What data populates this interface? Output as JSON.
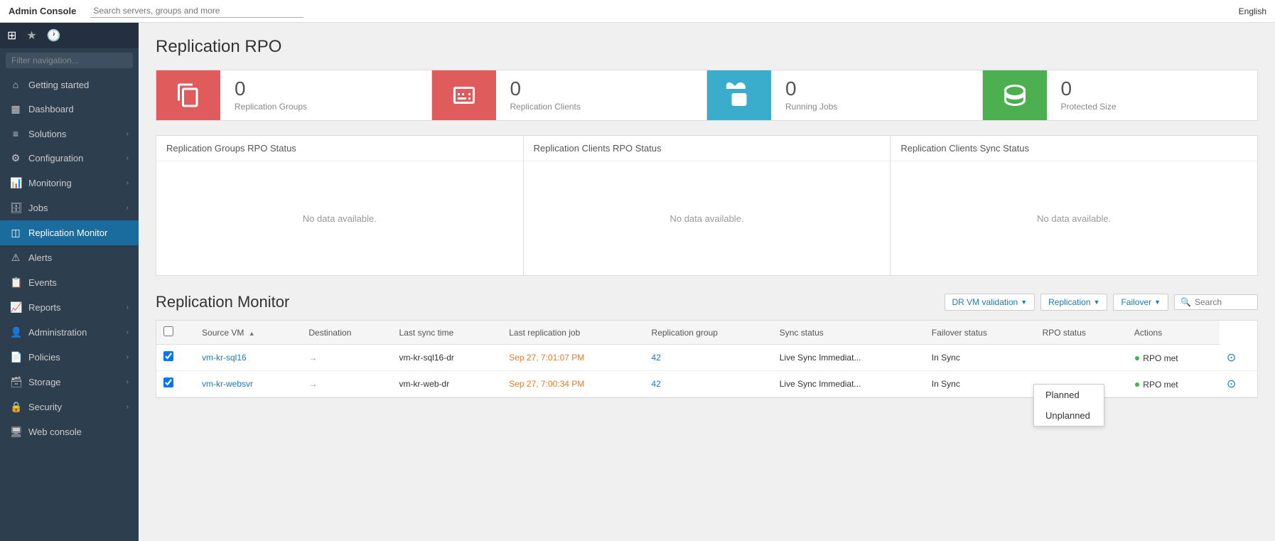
{
  "topbar": {
    "title": "Admin Console",
    "search_placeholder": "Search servers, groups and more",
    "language": "English"
  },
  "sidebar": {
    "filter_placeholder": "Filter navigation...",
    "items": [
      {
        "id": "getting-started",
        "label": "Getting started",
        "icon": "🏠",
        "active": false
      },
      {
        "id": "dashboard",
        "label": "Dashboard",
        "icon": "⊞",
        "active": false
      },
      {
        "id": "solutions",
        "label": "Solutions",
        "icon": "≡",
        "active": false
      },
      {
        "id": "configuration",
        "label": "Configuration",
        "icon": "⚙",
        "active": false
      },
      {
        "id": "monitoring",
        "label": "Monitoring",
        "icon": "📊",
        "active": false
      },
      {
        "id": "jobs",
        "label": "Jobs",
        "icon": "🗄",
        "active": false
      },
      {
        "id": "replication-monitor",
        "label": "Replication Monitor",
        "icon": "⬜",
        "active": true
      },
      {
        "id": "alerts",
        "label": "Alerts",
        "icon": "⚠",
        "active": false
      },
      {
        "id": "events",
        "label": "Events",
        "icon": "📋",
        "active": false
      },
      {
        "id": "reports",
        "label": "Reports",
        "icon": "📈",
        "active": false
      },
      {
        "id": "administration",
        "label": "Administration",
        "icon": "👤",
        "active": false
      },
      {
        "id": "policies",
        "label": "Policies",
        "icon": "📄",
        "active": false
      },
      {
        "id": "storage",
        "label": "Storage",
        "icon": "🗃",
        "active": false
      },
      {
        "id": "security",
        "label": "Security",
        "icon": "🔒",
        "active": false
      },
      {
        "id": "web-console",
        "label": "Web console",
        "icon": "🖥",
        "active": false
      }
    ]
  },
  "page": {
    "title": "Replication RPO",
    "stat_cards": [
      {
        "id": "replication-groups",
        "number": "0",
        "label": "Replication Groups",
        "color": "red",
        "icon_type": "copy"
      },
      {
        "id": "replication-clients",
        "number": "0",
        "label": "Replication Clients",
        "color": "red",
        "icon_type": "client"
      },
      {
        "id": "running-jobs",
        "number": "0",
        "label": "Running Jobs",
        "color": "blue",
        "icon_type": "jobs"
      },
      {
        "id": "protected-size",
        "number": "0",
        "label": "Protected Size",
        "color": "green",
        "icon_type": "shield"
      }
    ],
    "rpo_panels": [
      {
        "id": "groups-rpo",
        "title": "Replication Groups RPO Status",
        "no_data": "No data available."
      },
      {
        "id": "clients-rpo",
        "title": "Replication Clients RPO Status",
        "no_data": "No data available."
      },
      {
        "id": "clients-sync",
        "title": "Replication Clients Sync Status",
        "no_data": "No data available."
      }
    ],
    "monitor_section": {
      "title": "Replication Monitor",
      "filters": [
        {
          "id": "dr-vm-validation",
          "label": "DR VM validation"
        },
        {
          "id": "replication",
          "label": "Replication"
        },
        {
          "id": "failover",
          "label": "Failover"
        }
      ],
      "search_placeholder": "Search",
      "dropdown_items": [
        "Planned",
        "Unplanned"
      ],
      "table": {
        "columns": [
          "Source VM",
          "Destination",
          "Last sync time",
          "Last replication job",
          "Replication group",
          "Sync status",
          "Failover status",
          "RPO status",
          "Actions"
        ],
        "rows": [
          {
            "source_vm": "vm-kr-sql16",
            "destination": "vm-kr-sql16-dr",
            "last_sync_time": "Sep 27, 7:01:07 PM",
            "last_replication_job": "42",
            "replication_group": "Live Sync Immediat...",
            "sync_status": "In Sync",
            "failover_status": "",
            "rpo_status": "RPO met",
            "rpo_dot": "●"
          },
          {
            "source_vm": "vm-kr-websvr",
            "destination": "vm-kr-web-dr",
            "last_sync_time": "Sep 27, 7:00:34 PM",
            "last_replication_job": "42",
            "replication_group": "Live Sync Immediat...",
            "sync_status": "In Sync",
            "failover_status": "",
            "rpo_status": "RPO met",
            "rpo_dot": "●"
          }
        ]
      }
    }
  }
}
